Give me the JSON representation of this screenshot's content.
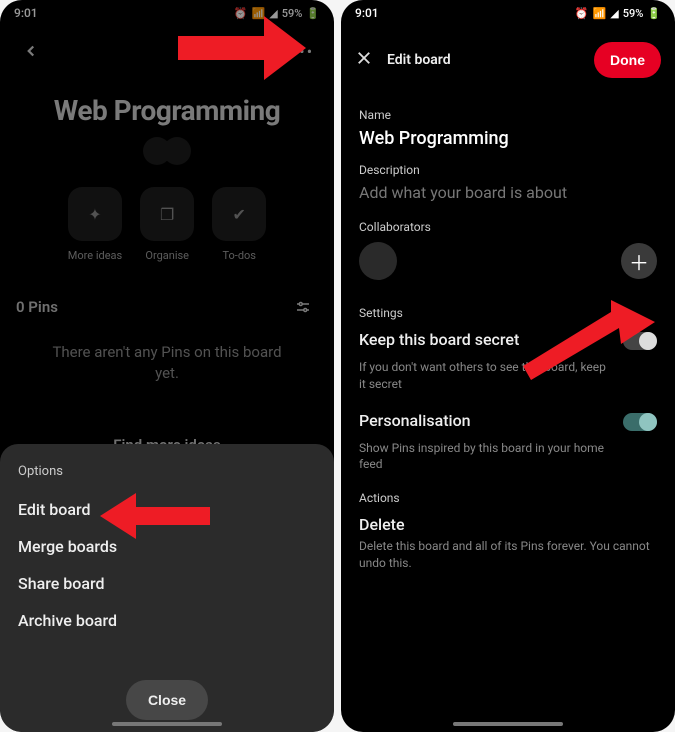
{
  "status": {
    "time": "9:01",
    "battery_pct": "59%"
  },
  "left": {
    "board_title": "Web Programming",
    "actions": [
      {
        "label": "More ideas",
        "icon": "sparkle-icon"
      },
      {
        "label": "Organise",
        "icon": "organise-icon"
      },
      {
        "label": "To-dos",
        "icon": "check-icon"
      }
    ],
    "pins_count": "0 Pins",
    "empty_message": "There aren't any Pins on this board yet.",
    "find_more": "Find more ideas",
    "sheet": {
      "title": "Options",
      "items": [
        "Edit board",
        "Merge boards",
        "Share board",
        "Archive board"
      ],
      "close_label": "Close"
    }
  },
  "right": {
    "header": {
      "title": "Edit board",
      "done_label": "Done"
    },
    "name": {
      "label": "Name",
      "value": "Web Programming"
    },
    "description": {
      "label": "Description",
      "placeholder": "Add what your board is about"
    },
    "collaborators": {
      "label": "Collaborators"
    },
    "settings": {
      "label": "Settings",
      "secret": {
        "title": "Keep this board secret",
        "desc": "If you don't want others to see this board, keep it secret",
        "value": false
      },
      "personalisation": {
        "title": "Personalisation",
        "desc": "Show Pins inspired by this board in your home feed",
        "value": true
      }
    },
    "actions": {
      "label": "Actions",
      "delete": {
        "title": "Delete",
        "desc": "Delete this board and all of its Pins forever. You cannot undo this."
      }
    }
  }
}
